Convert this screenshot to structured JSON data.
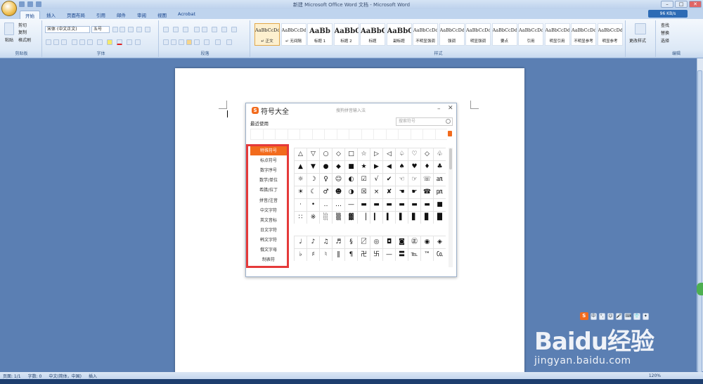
{
  "window": {
    "title": "新建 Microsoft Office Word 文档 - Microsoft Word",
    "min": "–",
    "max": "□",
    "close": "✕"
  },
  "tabs": [
    "开始",
    "插入",
    "页面布局",
    "引用",
    "邮件",
    "审阅",
    "视图",
    "Acrobat"
  ],
  "network_speed": "96 KB/s",
  "clipboard": {
    "paste": "粘贴",
    "cut": "剪切",
    "copy": "复制",
    "format_painter": "格式刷",
    "label": "剪贴板"
  },
  "font": {
    "name": "宋体 (中文正文)",
    "size": "五号",
    "label": "字体"
  },
  "paragraph": {
    "label": "段落"
  },
  "styles": {
    "label": "样式",
    "items": [
      {
        "sample": "AaBbCcDd",
        "name": "↵ 正文",
        "selected": true
      },
      {
        "sample": "AaBbCcDd",
        "name": "↵ 无间隔"
      },
      {
        "sample": "AaBb",
        "name": "标题 1"
      },
      {
        "sample": "AaBbC",
        "name": "标题 2"
      },
      {
        "sample": "AaBbC",
        "name": "标题"
      },
      {
        "sample": "AaBbC",
        "name": "副标题"
      },
      {
        "sample": "AaBbCcDd",
        "name": "不明显强调"
      },
      {
        "sample": "AaBbCcDd",
        "name": "强调"
      },
      {
        "sample": "AaBbCcDd",
        "name": "明显强调"
      },
      {
        "sample": "AaBbCcDd",
        "name": "要点"
      },
      {
        "sample": "AaBbCcDd",
        "name": "引用"
      },
      {
        "sample": "AaBbCcDd",
        "name": "明显引用"
      },
      {
        "sample": "AaBbCcDd",
        "name": "不明显参考"
      },
      {
        "sample": "AaBbCcDd",
        "name": "明显参考"
      }
    ],
    "change_styles": "更改样式"
  },
  "editing": {
    "find": "查找",
    "replace": "替换",
    "select": "选择",
    "label": "编辑"
  },
  "dialog": {
    "title": "符号大全",
    "subtitle": "搜狗拼音输入法",
    "recent_label": "最近使用",
    "search_placeholder": "搜索符号",
    "categories": [
      "特殊符号",
      "标点符号",
      "数字序号",
      "数学/单位",
      "希腊/拉丁",
      "拼音/注音",
      "中文字符",
      "英文音标",
      "日文字符",
      "韩文字符",
      "俄文字母",
      "制表符"
    ],
    "symbols_1": [
      "△",
      "▽",
      "○",
      "◇",
      "□",
      "☆",
      "▷",
      "◁",
      "♤",
      "♡",
      "◇",
      "♧",
      "▲",
      "▼",
      "●",
      "◆",
      "■",
      "★",
      "▶",
      "◀",
      "♠",
      "♥",
      "♦",
      "♣",
      "☼",
      "☽",
      "♀",
      "☺",
      "◐",
      "☑",
      "√",
      "✔",
      "☜",
      "☞",
      "☏",
      "㏂",
      "☀",
      "☾",
      "♂",
      "☻",
      "◑",
      "☒",
      "×",
      "✘",
      "☚",
      "☛",
      "☎",
      "㏘",
      "·",
      "•",
      "‥",
      "…",
      "—",
      "▬",
      "▬",
      "▬",
      "▬",
      "▬",
      "▬",
      "■",
      "∷",
      "※",
      "░",
      "▒",
      "▓",
      "▕",
      "▎",
      "▍",
      "▌",
      "▋",
      "▊",
      "█"
    ],
    "symbols_2": [
      "♩",
      "♪",
      "♫",
      "♬",
      "§",
      "〼",
      "◎",
      "◘",
      "◙",
      "㊣",
      "◉",
      "◈",
      "♭",
      "♯",
      "♮",
      "‖",
      "¶",
      "卍",
      "卐",
      "—",
      "〓",
      "℡",
      "™",
      "㏇"
    ]
  },
  "ime": {
    "logo": "S",
    "mode": "中",
    "punct": "°,",
    "emoji": "☺",
    "voice": "🎤",
    "keyboard": "⌨",
    "skin": "👕",
    "tools": "✦",
    "settings": "⚙"
  },
  "watermark": {
    "brand": "Baidu经验",
    "url": "jingyan.baidu.com"
  },
  "status": {
    "page": "页面: 1/1",
    "words": "字数: 0",
    "language": "中文(简体，中国)",
    "mode": "插入",
    "zoom": "120%"
  }
}
